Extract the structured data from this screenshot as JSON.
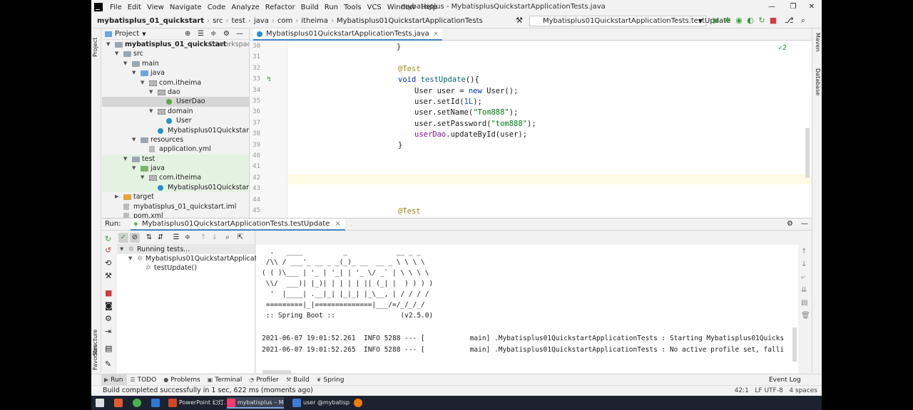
{
  "menu": [
    "File",
    "Edit",
    "View",
    "Navigate",
    "Code",
    "Analyze",
    "Refactor",
    "Build",
    "Run",
    "Tools",
    "VCS",
    "Window",
    "Help"
  ],
  "window_title": "mybatisplus - MybatisplusQuickstartApplicationTests.java",
  "window_controls": {
    "minimize": "—",
    "maximize": "❐",
    "close": "✕"
  },
  "breadcrumb": [
    "mybatisplus_01_quickstart",
    "src",
    "test",
    "java",
    "com",
    "itheima",
    "Mybatisplus01QuickstartApplicationTests"
  ],
  "run_config": "Mybatisplus01QuickstartApplicationTests.testUpdate",
  "side_labels": {
    "project": "Project",
    "structure": "Structure",
    "favorites": "Favorites",
    "maven": "Maven",
    "database": "Database"
  },
  "project": {
    "header": "Project",
    "tree": [
      {
        "label": "mybatisplus_01_quickstart",
        "extra": "D:\\workspace\\",
        "depth": 0,
        "arrow": "open",
        "icon": "folder",
        "bold": true
      },
      {
        "label": "src",
        "depth": 1,
        "arrow": "open",
        "icon": "folder"
      },
      {
        "label": "main",
        "depth": 2,
        "arrow": "open",
        "icon": "folder"
      },
      {
        "label": "java",
        "depth": 3,
        "arrow": "open",
        "icon": "folder-blue"
      },
      {
        "label": "com.itheima",
        "depth": 4,
        "arrow": "open",
        "icon": "pkg"
      },
      {
        "label": "dao",
        "depth": 5,
        "arrow": "open",
        "icon": "pkg"
      },
      {
        "label": "UserDao",
        "depth": 6,
        "icon": "interface",
        "selected": true
      },
      {
        "label": "domain",
        "depth": 5,
        "arrow": "open",
        "icon": "pkg"
      },
      {
        "label": "User",
        "depth": 6,
        "icon": "class"
      },
      {
        "label": "Mybatisplus01QuickstartAppl",
        "depth": 5,
        "icon": "class"
      },
      {
        "label": "resources",
        "depth": 3,
        "arrow": "open",
        "icon": "folder"
      },
      {
        "label": "application.yml",
        "depth": 4,
        "icon": "file"
      },
      {
        "label": "test",
        "depth": 2,
        "arrow": "open",
        "icon": "folder",
        "test": true
      },
      {
        "label": "java",
        "depth": 3,
        "arrow": "open",
        "icon": "folder-green",
        "test": true
      },
      {
        "label": "com.itheima",
        "depth": 4,
        "arrow": "open",
        "icon": "pkg",
        "test": true
      },
      {
        "label": "Mybatisplus01QuickstartAppl",
        "depth": 5,
        "icon": "class",
        "test": true
      },
      {
        "label": "target",
        "depth": 1,
        "arrow": "closed",
        "icon": "folder-orange"
      },
      {
        "label": "mybatisplus_01_quickstart.iml",
        "depth": 1,
        "icon": "file"
      },
      {
        "label": "pom.xml",
        "depth": 1,
        "icon": "file"
      }
    ]
  },
  "editor": {
    "tab": "Mybatisplus01QuickstartApplicationTests.java",
    "inspection": "✓2",
    "line_numbers": [
      "30",
      "31",
      "32",
      "33",
      "34",
      "35",
      "36",
      "37",
      "38",
      "39",
      "40",
      "41",
      "42",
      "43",
      "44",
      "45"
    ],
    "code": {
      "l30": "}",
      "l32": "@Test",
      "l33_kw": "void",
      "l33_fn": "testUpdate",
      "l33_rest": "(){",
      "l34_a": "User user = ",
      "l34_kw": "new",
      "l34_b": " User();",
      "l35_a": "user.setId(",
      "l35_num": "1L",
      "l35_b": ");",
      "l36_a": "user.setName(",
      "l36_str": "\"Tom888\"",
      "l36_b": ");",
      "l37_a": "user.setPassword(",
      "l37_str": "\"tom888\"",
      "l37_b": ");",
      "l38_fld": "userDao",
      "l38_b": ".updateById(user);",
      "l39": "}",
      "l45": "@Test"
    }
  },
  "run": {
    "label": "Run:",
    "tab": "Mybatisplus01QuickstartApplicationTests.testUpdate",
    "tree": [
      {
        "label": "Running tests...",
        "depth": 0
      },
      {
        "label": "Mybatisplus01QuickstartApplicationTe",
        "depth": 1
      },
      {
        "label": "testUpdate()",
        "depth": 2
      }
    ],
    "console": [
      "  .   ____          _            __ _ _",
      " /\\\\ / ___'_ __ _ _(_)_ __  __ _ \\ \\ \\ \\",
      "( ( )\\___ | '_ | '_| | '_ \\/ _` | \\ \\ \\ \\",
      " \\\\/  ___)| |_)| | | | | || (_| |  ) ) ) )",
      "  '  |____| .__|_| |_|_| |_\\__, | / / / /",
      " =========|_|==============|___/=/_/_/_/",
      " :: Spring Boot ::                (v2.5.0)",
      "",
      "2021-06-07 19:01:52.261  INFO 5288 --- [           main] .Mybatisplus01QuickstartApplicationTests : Starting Mybatisplus01Quicks",
      "2021-06-07 19:01:52.265  INFO 5288 --- [           main] .Mybatisplus01QuickstartApplicationTests : No active profile set, falli"
    ]
  },
  "bottom_tabs": [
    {
      "label": "Run",
      "icon": "▶",
      "active": true
    },
    {
      "label": "TODO",
      "icon": "☰"
    },
    {
      "label": "Problems",
      "icon": "●"
    },
    {
      "label": "Terminal",
      "icon": "▣"
    },
    {
      "label": "Profiler",
      "icon": "◔"
    },
    {
      "label": "Build",
      "icon": "⚒"
    },
    {
      "label": "Spring",
      "icon": "❦"
    }
  ],
  "status": {
    "message": "Build completed successfully in 1 sec, 622 ms (moments ago)",
    "event_log": "Event Log",
    "position": "42:1",
    "encoding": "LF  UTF-8",
    "indent": "4 spaces"
  },
  "taskbar": [
    {
      "label": "PowerPoint 幻灯...",
      "color": "#d24726"
    },
    {
      "label": "mybatisplus – My...",
      "color": "#fc3a6c",
      "active": true
    },
    {
      "label": "user @mybatispl...",
      "color": "#3d7cd6"
    }
  ],
  "colors": {
    "accent": "#4083c9",
    "selection": "#d5d5d5",
    "test_bg": "#e4f2e1",
    "current_line": "#fffae3"
  }
}
